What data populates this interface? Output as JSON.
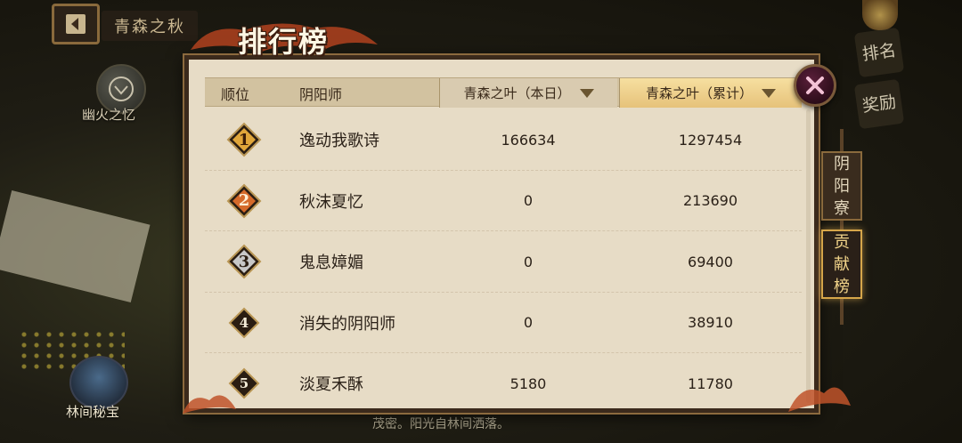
{
  "background": {
    "back_title": "青森之秋",
    "left_item_label": "幽火之忆",
    "treasure_label": "林间秘宝",
    "bottom_text": "茂密。阳光自林间洒落。",
    "right_tabs": [
      "排名",
      "奖励"
    ]
  },
  "panel": {
    "title": "排行榜",
    "columns": {
      "rank": "顺位",
      "name": "阴阳师",
      "daily": "青森之叶（本日）",
      "total": "青森之叶（累计）"
    },
    "rows": [
      {
        "rank": "1",
        "name": "逸动我歌诗",
        "daily": "166634",
        "total": "1297454"
      },
      {
        "rank": "2",
        "name": "秋沫夏忆",
        "daily": "0",
        "total": "213690"
      },
      {
        "rank": "3",
        "name": "鬼息嫜媚",
        "daily": "0",
        "total": "69400"
      },
      {
        "rank": "4",
        "name": "消失的阴阳师",
        "daily": "0",
        "total": "38910"
      },
      {
        "rank": "5",
        "name": "淡夏禾酥",
        "daily": "5180",
        "total": "11780"
      }
    ]
  },
  "side_tabs": {
    "yinyang": [
      "阴",
      "阳",
      "寮"
    ],
    "contrib": [
      "贡",
      "献",
      "榜"
    ]
  },
  "colors": {
    "panel_bg": "#e7dcc6",
    "active_tab": "#e6c27a",
    "rank1": "#e0a63a",
    "rank2": "#d56a2a",
    "rank3": "#c7c7c7",
    "rank_other": "#f2ead6"
  }
}
